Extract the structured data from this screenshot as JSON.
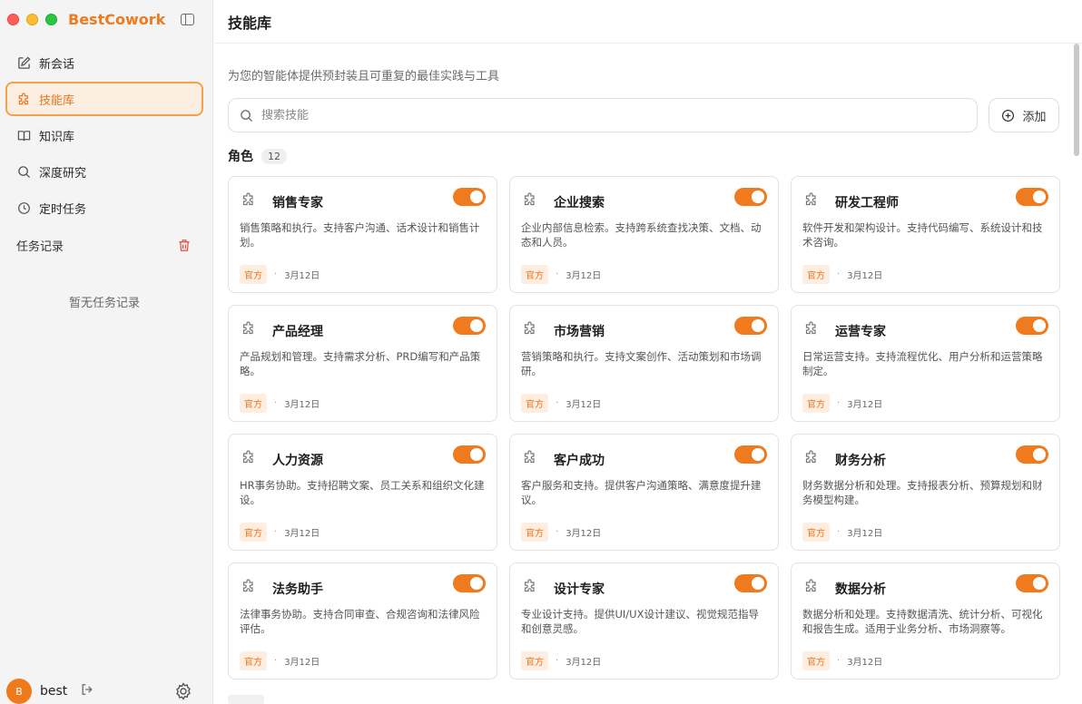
{
  "app": {
    "brand": "BestCowork"
  },
  "sidebar": {
    "items": [
      {
        "label": "新会话",
        "icon": "edit-icon"
      },
      {
        "label": "技能库",
        "icon": "puzzle-icon",
        "active": true
      },
      {
        "label": "知识库",
        "icon": "book-icon"
      },
      {
        "label": "深度研究",
        "icon": "search-icon"
      },
      {
        "label": "定时任务",
        "icon": "clock-icon"
      }
    ],
    "history_title": "任务记录",
    "history_empty": "暂无任务记录",
    "user": {
      "initial": "B",
      "name": "best"
    }
  },
  "header": {
    "title": "技能库"
  },
  "main": {
    "subtitle": "为您的智能体提供预封装且可重复的最佳实践与工具",
    "search_placeholder": "搜索技能",
    "add_label": "添加",
    "section": {
      "title": "角色",
      "count": "12"
    }
  },
  "cards": [
    {
      "name": "销售专家",
      "desc": "销售策略和执行。支持客户沟通、话术设计和销售计划。",
      "tag": "官方",
      "date": "3月12日",
      "enabled": true
    },
    {
      "name": "企业搜索",
      "desc": "企业内部信息检索。支持跨系统查找决策、文档、动态和人员。",
      "tag": "官方",
      "date": "3月12日",
      "enabled": true
    },
    {
      "name": "研发工程师",
      "desc": "软件开发和架构设计。支持代码编写、系统设计和技术咨询。",
      "tag": "官方",
      "date": "3月12日",
      "enabled": true
    },
    {
      "name": "产品经理",
      "desc": "产品规划和管理。支持需求分析、PRD编写和产品策略。",
      "tag": "官方",
      "date": "3月12日",
      "enabled": true
    },
    {
      "name": "市场营销",
      "desc": "营销策略和执行。支持文案创作、活动策划和市场调研。",
      "tag": "官方",
      "date": "3月12日",
      "enabled": true
    },
    {
      "name": "运营专家",
      "desc": "日常运营支持。支持流程优化、用户分析和运营策略制定。",
      "tag": "官方",
      "date": "3月12日",
      "enabled": true
    },
    {
      "name": "人力资源",
      "desc": "HR事务协助。支持招聘文案、员工关系和组织文化建设。",
      "tag": "官方",
      "date": "3月12日",
      "enabled": true
    },
    {
      "name": "客户成功",
      "desc": "客户服务和支持。提供客户沟通策略、满意度提升建议。",
      "tag": "官方",
      "date": "3月12日",
      "enabled": true
    },
    {
      "name": "财务分析",
      "desc": "财务数据分析和处理。支持报表分析、预算规划和财务模型构建。",
      "tag": "官方",
      "date": "3月12日",
      "enabled": true
    },
    {
      "name": "法务助手",
      "desc": "法律事务协助。支持合同审查、合规咨询和法律风险评估。",
      "tag": "官方",
      "date": "3月12日",
      "enabled": true
    },
    {
      "name": "设计专家",
      "desc": "专业设计支持。提供UI/UX设计建议、视觉规范指导和创意灵感。",
      "tag": "官方",
      "date": "3月12日",
      "enabled": true
    },
    {
      "name": "数据分析",
      "desc": "数据分析和处理。支持数据清洗、统计分析、可视化和报告生成。适用于业务分析、市场洞察等。",
      "tag": "官方",
      "date": "3月12日",
      "enabled": true
    }
  ],
  "colors": {
    "accent": "#f07a1e",
    "tag_bg": "#fdeee1"
  }
}
